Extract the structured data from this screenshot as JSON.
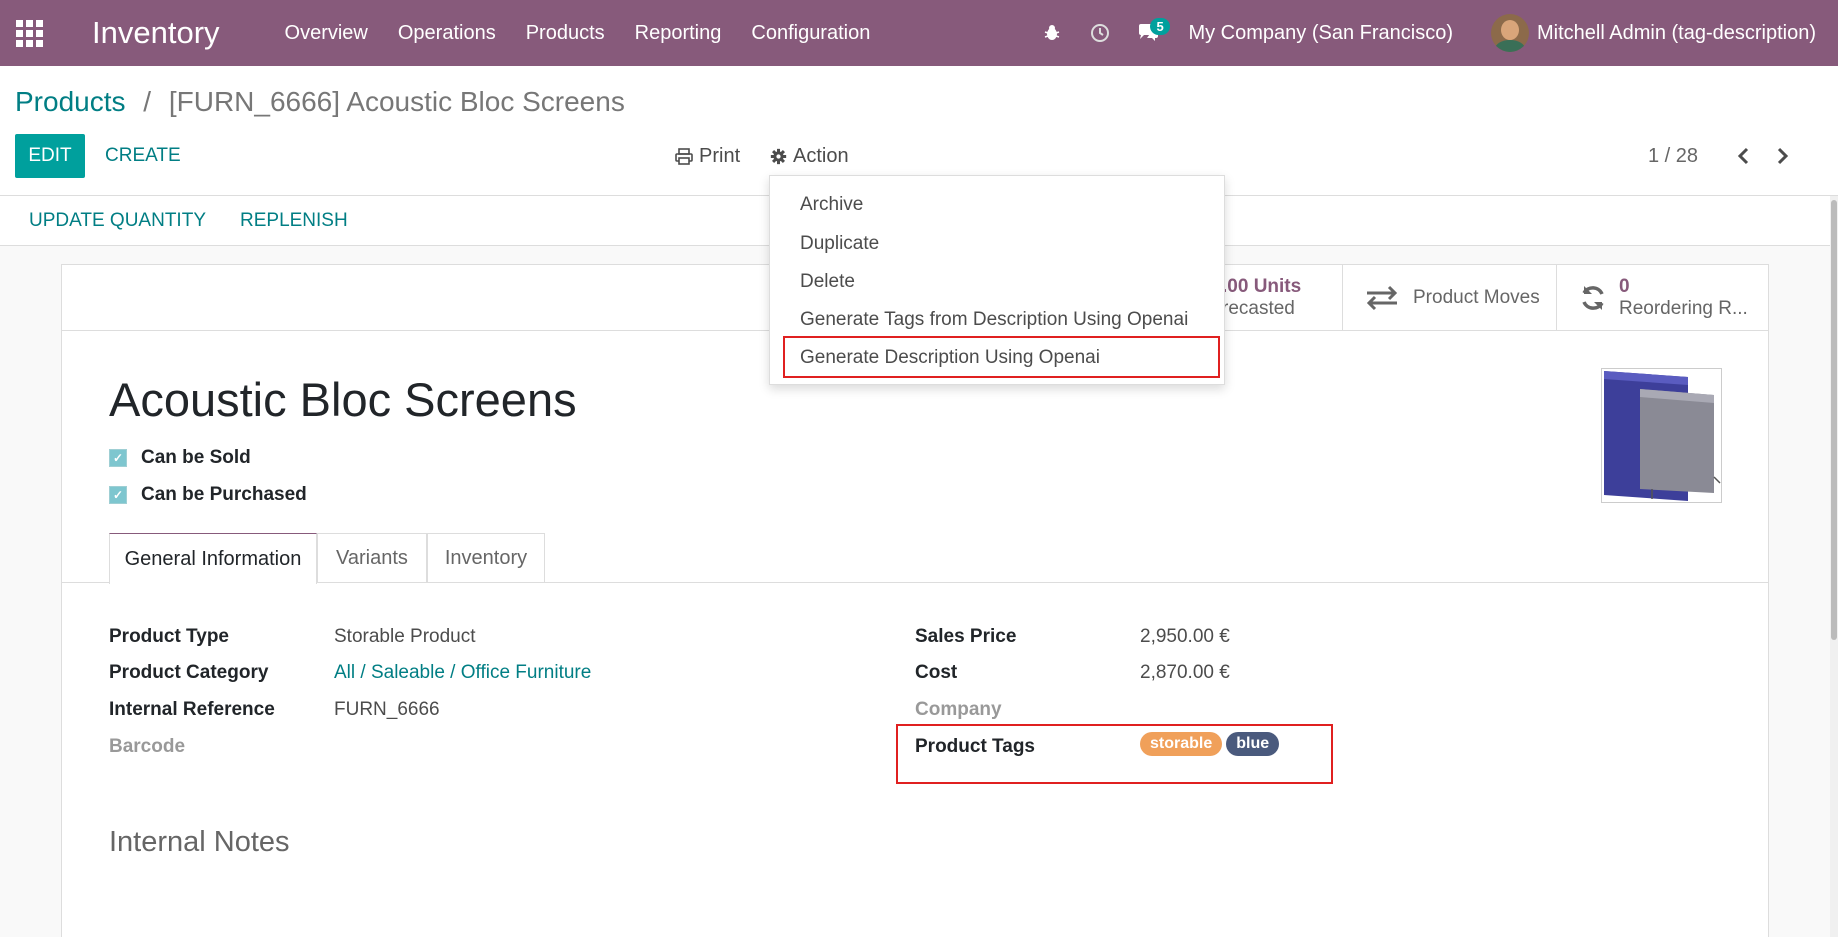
{
  "navbar": {
    "brand": "Inventory",
    "menu": [
      "Overview",
      "Operations",
      "Products",
      "Reporting",
      "Configuration"
    ],
    "message_count": "5",
    "company": "My Company (San Francisco)",
    "user": "Mitchell Admin (tag-description)"
  },
  "breadcrumb": {
    "parent": "Products",
    "separator": "/",
    "current": "[FURN_6666] Acoustic Bloc Screens"
  },
  "toolbar": {
    "edit_label": "EDIT",
    "create_label": "CREATE",
    "print_label": "Print",
    "action_label": "Action",
    "pager": "1 / 28"
  },
  "action_menu": [
    "Archive",
    "Duplicate",
    "Delete",
    "Generate Tags from Description Using Openai",
    "Generate Description Using Openai"
  ],
  "statusbar": {
    "update_quantity": "UPDATE QUANTITY",
    "replenish": "REPLENISH"
  },
  "smart_buttons": {
    "forecast_value": ".00 Units",
    "forecast_label": "recasted",
    "moves_label": "Product Moves",
    "reorder_value": "0",
    "reorder_label": "Reordering R..."
  },
  "product": {
    "name": "Acoustic Bloc Screens",
    "can_be_sold": "Can be Sold",
    "can_be_purchased": "Can be Purchased"
  },
  "tabs": [
    "General Information",
    "Variants",
    "Inventory"
  ],
  "fields": {
    "product_type_label": "Product Type",
    "product_type": "Storable Product",
    "category_label": "Product Category",
    "category": "All / Saleable / Office Furniture",
    "internal_ref_label": "Internal Reference",
    "internal_ref": "FURN_6666",
    "barcode_label": "Barcode",
    "sales_price_label": "Sales Price",
    "sales_price": "2,950.00 €",
    "cost_label": "Cost",
    "cost": "2,870.00 €",
    "company_label": "Company",
    "tags_label": "Product Tags",
    "tags": [
      {
        "label": "storable",
        "color": "#f0a05a"
      },
      {
        "label": "blue",
        "color": "#4a5a7d"
      }
    ]
  },
  "notes_title": "Internal Notes",
  "colors": {
    "navbar": "#875a7b",
    "primary": "#00a09d",
    "link": "#017e84",
    "highlight": "#e02020"
  }
}
